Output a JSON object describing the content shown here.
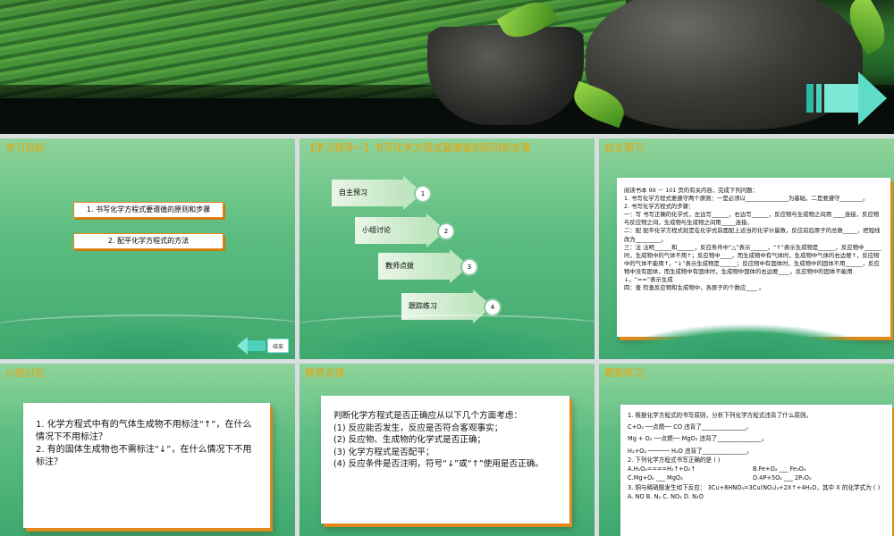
{
  "slides": {
    "s1": {
      "title": "学习目标",
      "items": [
        "1. 书写化学方程式要遵循的原则和步骤",
        "2. 配平化学方程式的方法"
      ],
      "nav_label": "结束"
    },
    "s2": {
      "title": "【学习指导一】书写化学方程式要遵循的原则和步骤",
      "steps": [
        {
          "label": "自主预习",
          "num": "1"
        },
        {
          "label": "小组讨论",
          "num": "2"
        },
        {
          "label": "教师点拨",
          "num": "3"
        },
        {
          "label": "跟踪练习",
          "num": "4"
        }
      ]
    },
    "s3": {
      "title": "自主预习",
      "lines": [
        "阅读书本 99 － 101 页的有关内容，完成下列问题：",
        "1. 书写化学方程式要遵守两个原则：一是必须以_______________为基础，二是要遵守________。",
        "2. 书写化学方程式的步骤：",
        "一：写    书写正确的化学式，左边写______，右边写______，反应物与生成物之间用 ____连接，反应物与反应物之间，生成物与生成物之间用_____连接。",
        "二：配    配平化学方程式就是在化学式前面配上适当的化学计量数，反应前后原子的总数_____，把短线改为_________。",
        "三：注    注明______和______，反应条件中“△”表示______，“↑”表示生成物是______，反应物中______时，生成物中的气体不用↑；反应物中____，而生成物中有气体时，生成物中气体的右边要↑，反应物中的气体不能用↑。“↓”表示生成物是______；反应物中有固体时，生成物中的固体不用______，反应物中没有固体，而生成物中有固体时，生成物中固体的右边要____，反应物中的固体不能用↓。“==”表示生成",
        "四：查    检查反应物和生成物中，各原子的个数应____ 。"
      ]
    },
    "s4": {
      "title": "小组讨论",
      "lines": [
        "1. 化学方程式中有的气体生成物不用标注“↑”，在什么情况下不用标注？",
        "2. 有的固体生成物也不需标注“↓”，在什么情况下不用标注？"
      ]
    },
    "s5": {
      "title": "教师点拨",
      "lines": [
        "判断化学方程式是否正确应从以下几个方面考虑：",
        "(1) 反应能否发生，反应是否符合客观事实；",
        "(2) 反应物、生成物的化学式是否正确；",
        "(3) 化学方程式是否配平；",
        "(4) 反应条件是否注明，符号“↓”或“↑”使用是否正确。"
      ]
    },
    "s6": {
      "title": "跟踪练习",
      "q1": "1. 根据化学方程式的书写原则，分析下列化学方程式违背了什么原则。",
      "eq1": "C+O₂ ──点燃── CO 违背了_______________。",
      "eq2": "Mg + O₂ ──点燃── MgO₂ 违背了_______________。",
      "eq3": "H₂+O₂ ────── H₂O 违背了_______________。",
      "q2": "2. 下列化学方程式书写正确的是 ( )",
      "optA": "A.H₂O₂====H₂↑+O₂↑",
      "optB": "B.Fe+O₂ ___ Fe₃O₄",
      "optC": "C.Mg+O₂ ___ MgO₂",
      "optD": "D.4P+5O₂ ___ 2P₂O₅",
      "q3": "3. 铜与稀硝酸发生如下反应：  3Cu+8HNO₃=3Cu(NO₃)₂+2X↑+4H₂O，其中 X 的化学式为 (    )",
      "q3opts": "A. NO    B. N₂    C. NO₂    D. N₂O"
    }
  },
  "colors": {
    "title": "#f0a000",
    "accent": "#e08a1a",
    "slide_green": "#5fbe82"
  },
  "icons": {
    "next": "teal-arrow-icon",
    "back": "back-arrow-icon"
  }
}
